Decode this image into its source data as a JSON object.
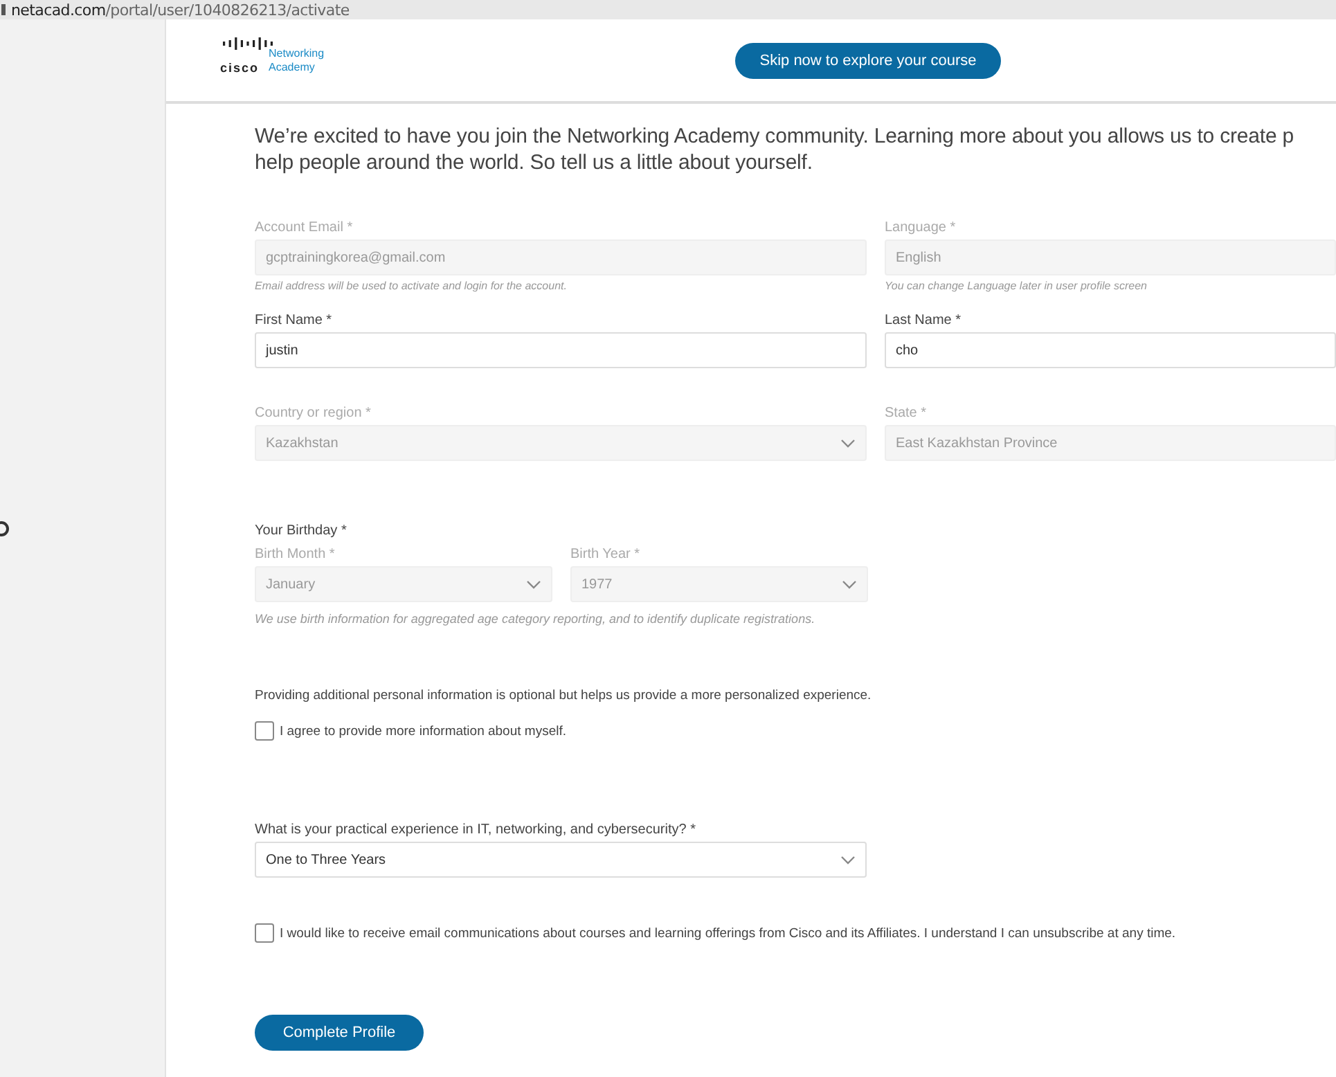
{
  "browser": {
    "url_domain": "netacad.com",
    "url_path": "/portal/user/1040826213/activate"
  },
  "header": {
    "logo": {
      "wordmark": "cisco",
      "line1": "Networking",
      "line2": "Academy"
    },
    "skip_button": "Skip now to explore your course"
  },
  "intro": [
    "We’re excited to have you join the Networking Academy community. Learning more about you allows us to create p",
    "help people around the world. So tell us a little about yourself."
  ],
  "rows": [
    {
      "fields": [
        {
          "kind": "text",
          "label": "Account Email *",
          "value": "gcptrainingkorea@gmail.com",
          "disabled": true,
          "hint": "Email address will be used to activate and login for the account."
        },
        {
          "kind": "text",
          "label": "Language *",
          "value": "English",
          "disabled": true,
          "hint": "You can change Language later in user profile screen"
        }
      ]
    },
    {
      "fields": [
        {
          "kind": "text",
          "label": "First Name *",
          "value": "justin",
          "disabled": false
        },
        {
          "kind": "text",
          "label": "Last Name *",
          "value": "cho",
          "disabled": false
        }
      ]
    },
    {
      "fields": [
        {
          "kind": "select",
          "label": "Country or region *",
          "value": "Kazakhstan",
          "disabled": true
        },
        {
          "kind": "text",
          "label": "State *",
          "value": "East Kazakhstan Province",
          "disabled": true
        }
      ]
    }
  ],
  "birthday": {
    "title": "Your Birthday *",
    "fields": [
      {
        "kind": "select",
        "label": "Birth Month *",
        "value": "January",
        "disabled": true
      },
      {
        "kind": "select",
        "label": "Birth Year *",
        "value": "1977",
        "disabled": true
      }
    ],
    "note": "We use birth information for aggregated age category reporting, and to identify duplicate registrations."
  },
  "optional_text": "Providing additional personal information is optional but helps us provide a more personalized experience.",
  "agree_checkbox": {
    "label": "I agree to provide more information about myself.",
    "checked": false
  },
  "experience": {
    "kind": "select",
    "label": "What is your practical experience in IT, networking, and cybersecurity? *",
    "value": "One to Three Years",
    "disabled": false
  },
  "email_checkbox": {
    "label": "I would like to receive email communications about courses and learning offerings from Cisco and its Affiliates. I understand I can unsubscribe at any time.",
    "checked": false
  },
  "submit_button": "Complete Profile"
}
